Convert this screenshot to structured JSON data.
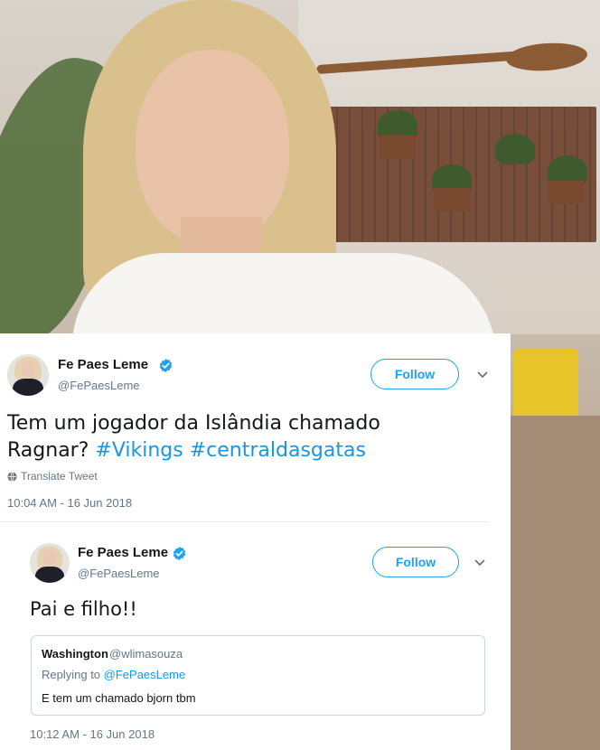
{
  "tweet": {
    "author_name": "Fe Paes Leme",
    "author_handle": "@FePaesLeme",
    "follow_label": "Follow",
    "text_line1": "Tem um jogador da Islândia chamado",
    "text_line2_prefix": "Ragnar? ",
    "hashtag1": "#Vikings",
    "hashtag_gap": " ",
    "hashtag2": "#centraldasgatas",
    "translate_label": "Translate Tweet",
    "timestamp": "10:04 AM - 16 Jun 2018"
  },
  "reply": {
    "author_name": "Fe Paes Leme",
    "author_handle": "@FePaesLeme",
    "follow_label": "Follow",
    "text": "Pai e filho!!",
    "timestamp": "10:12 AM - 16 Jun 2018",
    "quoted": {
      "author_name": "Washington",
      "author_handle": "@wlimasouza",
      "replying_prefix": "Replying to ",
      "replying_mention": "@FePaesLeme",
      "text": "E tem um chamado bjorn tbm"
    }
  },
  "colors": {
    "link_blue": "#1b95e0",
    "follow_blue": "#1da1f2",
    "text_dark": "#14171a",
    "text_gray": "#657786",
    "accent_yellow_cushion": "#e7c42a"
  },
  "icons": {
    "verified": "verified-badge-icon",
    "chevron": "chevron-down-icon",
    "globe": "globe-icon"
  }
}
